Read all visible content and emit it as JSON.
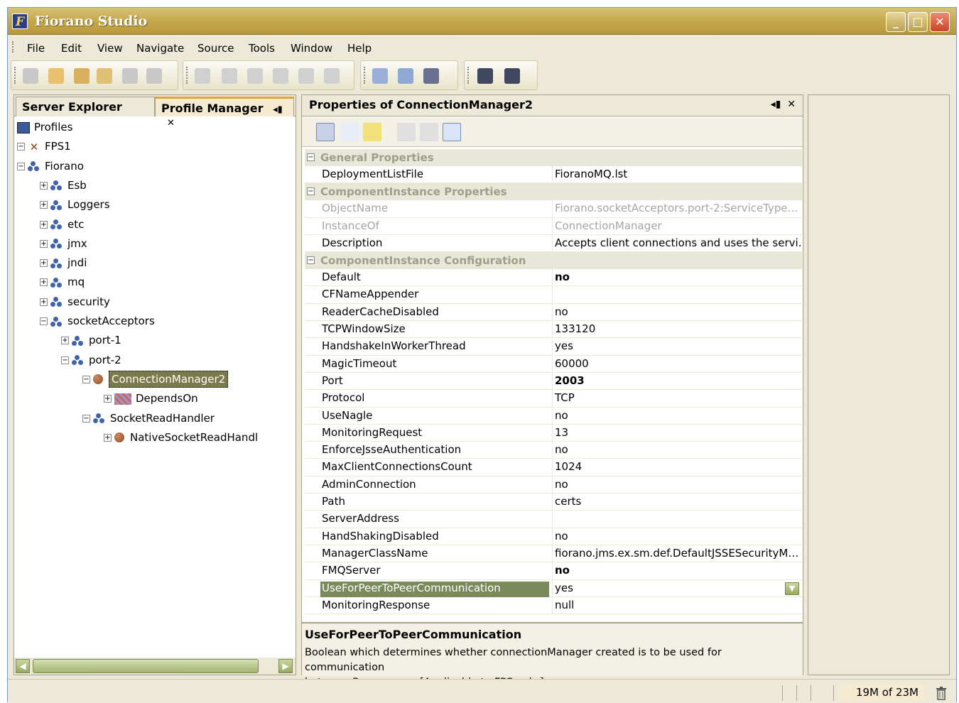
{
  "window": {
    "title": "Fiorano Studio",
    "icon_letter": "F"
  },
  "menu": [
    "File",
    "Edit",
    "View",
    "Navigate",
    "Source",
    "Tools",
    "Window",
    "Help"
  ],
  "left_panel": {
    "tabs": [
      {
        "label": "Server Explorer",
        "active": false
      },
      {
        "label": "Profile Manager",
        "active": true
      }
    ],
    "tree": [
      {
        "label": "Profiles",
        "depth": 0,
        "icon": "profiles-icon",
        "expander": ""
      },
      {
        "label": "FPS1",
        "depth": 0,
        "icon": "server-tools-icon",
        "expander": "-"
      },
      {
        "label": "Fiorano",
        "depth": 1,
        "icon": "package-icon",
        "expander": "-"
      },
      {
        "label": "Esb",
        "depth": 2,
        "icon": "package-icon",
        "expander": "+"
      },
      {
        "label": "Loggers",
        "depth": 2,
        "icon": "package-icon",
        "expander": "+"
      },
      {
        "label": "etc",
        "depth": 2,
        "icon": "package-icon",
        "expander": "+"
      },
      {
        "label": "jmx",
        "depth": 2,
        "icon": "package-icon",
        "expander": "+"
      },
      {
        "label": "jndi",
        "depth": 2,
        "icon": "package-icon",
        "expander": "+"
      },
      {
        "label": "mq",
        "depth": 2,
        "icon": "package-icon",
        "expander": "+"
      },
      {
        "label": "security",
        "depth": 2,
        "icon": "package-icon",
        "expander": "+"
      },
      {
        "label": "socketAcceptors",
        "depth": 2,
        "icon": "package-icon",
        "expander": "-"
      },
      {
        "label": "port-1",
        "depth": 3,
        "icon": "package-icon",
        "expander": "+"
      },
      {
        "label": "port-2",
        "depth": 3,
        "icon": "package-icon",
        "expander": "-"
      },
      {
        "label": "ConnectionManager2",
        "depth": 4,
        "icon": "bean-icon",
        "expander": "-",
        "selected": true
      },
      {
        "label": "DependsOn",
        "depth": 5,
        "icon": "dependency-icon",
        "expander": "+"
      },
      {
        "label": "SocketReadHandler",
        "depth": 4,
        "icon": "package-icon",
        "expander": "-"
      },
      {
        "label": "NativeSocketReadHandl",
        "depth": 5,
        "icon": "bean-icon",
        "expander": "+"
      }
    ]
  },
  "properties": {
    "title": "Properties of ConnectionManager2",
    "sections": [
      {
        "name": "General Properties",
        "rows": [
          {
            "name": "DeploymentListFile",
            "value": "FioranoMQ.lst"
          }
        ]
      },
      {
        "name": "ComponentInstance Properties",
        "rows": [
          {
            "name": "ObjectName",
            "value": "Fiorano.socketAcceptors.port-2:ServiceType…",
            "disabled": true
          },
          {
            "name": "InstanceOf",
            "value": "ConnectionManager",
            "disabled": true
          },
          {
            "name": "Description",
            "value": "Accepts client connections and uses the servi…"
          }
        ]
      },
      {
        "name": "ComponentInstance Configuration",
        "rows": [
          {
            "name": "Default",
            "value": "no",
            "bold": true
          },
          {
            "name": "CFNameAppender",
            "value": ""
          },
          {
            "name": "ReaderCacheDisabled",
            "value": "no"
          },
          {
            "name": "TCPWindowSize",
            "value": "133120"
          },
          {
            "name": "HandshakeInWorkerThread",
            "value": "yes"
          },
          {
            "name": "MagicTimeout",
            "value": "60000"
          },
          {
            "name": "Port",
            "value": "2003",
            "bold": true
          },
          {
            "name": "Protocol",
            "value": "TCP"
          },
          {
            "name": "UseNagle",
            "value": "no"
          },
          {
            "name": "MonitoringRequest",
            "value": "13"
          },
          {
            "name": "EnforceJsseAuthentication",
            "value": "no"
          },
          {
            "name": "MaxClientConnectionsCount",
            "value": "1024"
          },
          {
            "name": "AdminConnection",
            "value": "no"
          },
          {
            "name": "Path",
            "value": "certs"
          },
          {
            "name": "ServerAddress",
            "value": ""
          },
          {
            "name": "HandShakingDisabled",
            "value": "no"
          },
          {
            "name": "ManagerClassName",
            "value": "fiorano.jms.ex.sm.def.DefaultJSSESecurityM…"
          },
          {
            "name": "FMQServer",
            "value": "no",
            "bold": true
          },
          {
            "name": "UseForPeerToPeerCommunication",
            "value": "yes",
            "selected": true,
            "dropdown": true
          },
          {
            "name": "MonitoringResponse",
            "value": "null"
          }
        ]
      }
    ],
    "description": {
      "title": "UseForPeerToPeerCommunication",
      "line1": "Boolean which determines whether connectionManager created is to be used for communication",
      "line2": "between Peer servers.[Applicable to FPS only.]."
    }
  },
  "status": {
    "memory": "19M of 23M"
  },
  "colors": {
    "title_bar": "#c7ab4f",
    "selection": "#7a7a4a",
    "accent_tab": "#e2a039"
  }
}
